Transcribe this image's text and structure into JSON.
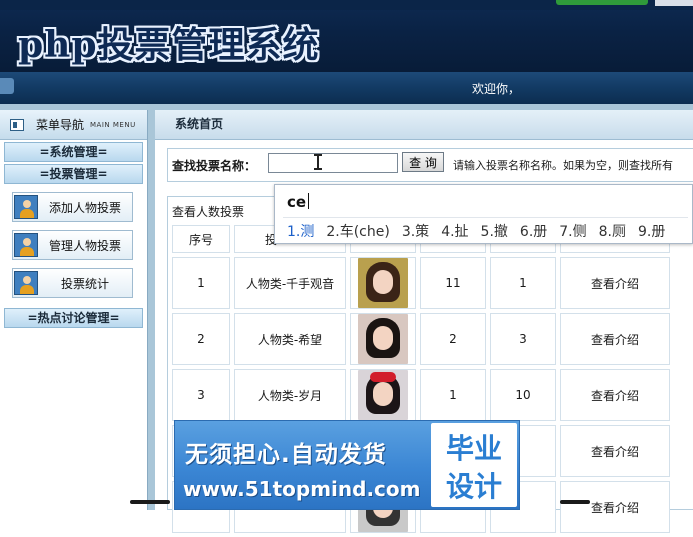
{
  "app_title": "php投票管理系统",
  "welcome_text": "欢迎你，",
  "sidebar": {
    "title": "菜单导航",
    "subtitle": "MAIN MENU",
    "sections": [
      {
        "label": "=系统管理="
      },
      {
        "label": "=投票管理="
      },
      {
        "label": "=热点讨论管理="
      }
    ],
    "items": [
      {
        "label": "添加人物投票"
      },
      {
        "label": "管理人物投票"
      },
      {
        "label": "投票统计"
      }
    ]
  },
  "main": {
    "breadcrumb": "系统首页",
    "search": {
      "label": "查找投票名称：",
      "value": "",
      "button": "查 询",
      "hint": "请输入投票名称名称。如果为空，则查找所有"
    },
    "table": {
      "caption": "查看人数投票",
      "headers": [
        "序号",
        "投",
        "",
        "",
        "",
        ""
      ],
      "rows": [
        {
          "no": "1",
          "name": "人物类-千手观音",
          "count": "11",
          "rank": "1",
          "action": "查看介绍",
          "photo": {
            "bg": "#b9a04e",
            "hair": "#3b2417"
          }
        },
        {
          "no": "2",
          "name": "人物类-希望",
          "count": "2",
          "rank": "3",
          "action": "查看介绍",
          "photo": {
            "bg": "#d8c7c0",
            "hair": "#1a1412"
          }
        },
        {
          "no": "3",
          "name": "人物类-岁月",
          "count": "1",
          "rank": "10",
          "action": "查看介绍",
          "photo": {
            "bg": "#d9d4d8",
            "hair": "#1c1517"
          }
        },
        {
          "no": "",
          "name": "",
          "count": "",
          "rank": "",
          "action": "查看介绍",
          "photo": {
            "bg": "#6aa15a",
            "hair": "#2a2a22"
          }
        },
        {
          "no": "",
          "name": "",
          "count": "",
          "rank": "",
          "action": "查看介绍",
          "photo": {
            "bg": "#c9c9c9",
            "hair": "#333333"
          }
        }
      ]
    }
  },
  "ime": {
    "composition": "ce",
    "candidates": [
      "1.测",
      "2.车(che)",
      "3.策",
      "4.扯",
      "5.撤",
      "6.册",
      "7.侧",
      "8.厕",
      "9.册"
    ]
  },
  "ad": {
    "slogan": "无须担心.自动发货",
    "url": "www.51topmind.com",
    "badge_line1": "毕业",
    "badge_line2": "设计"
  }
}
